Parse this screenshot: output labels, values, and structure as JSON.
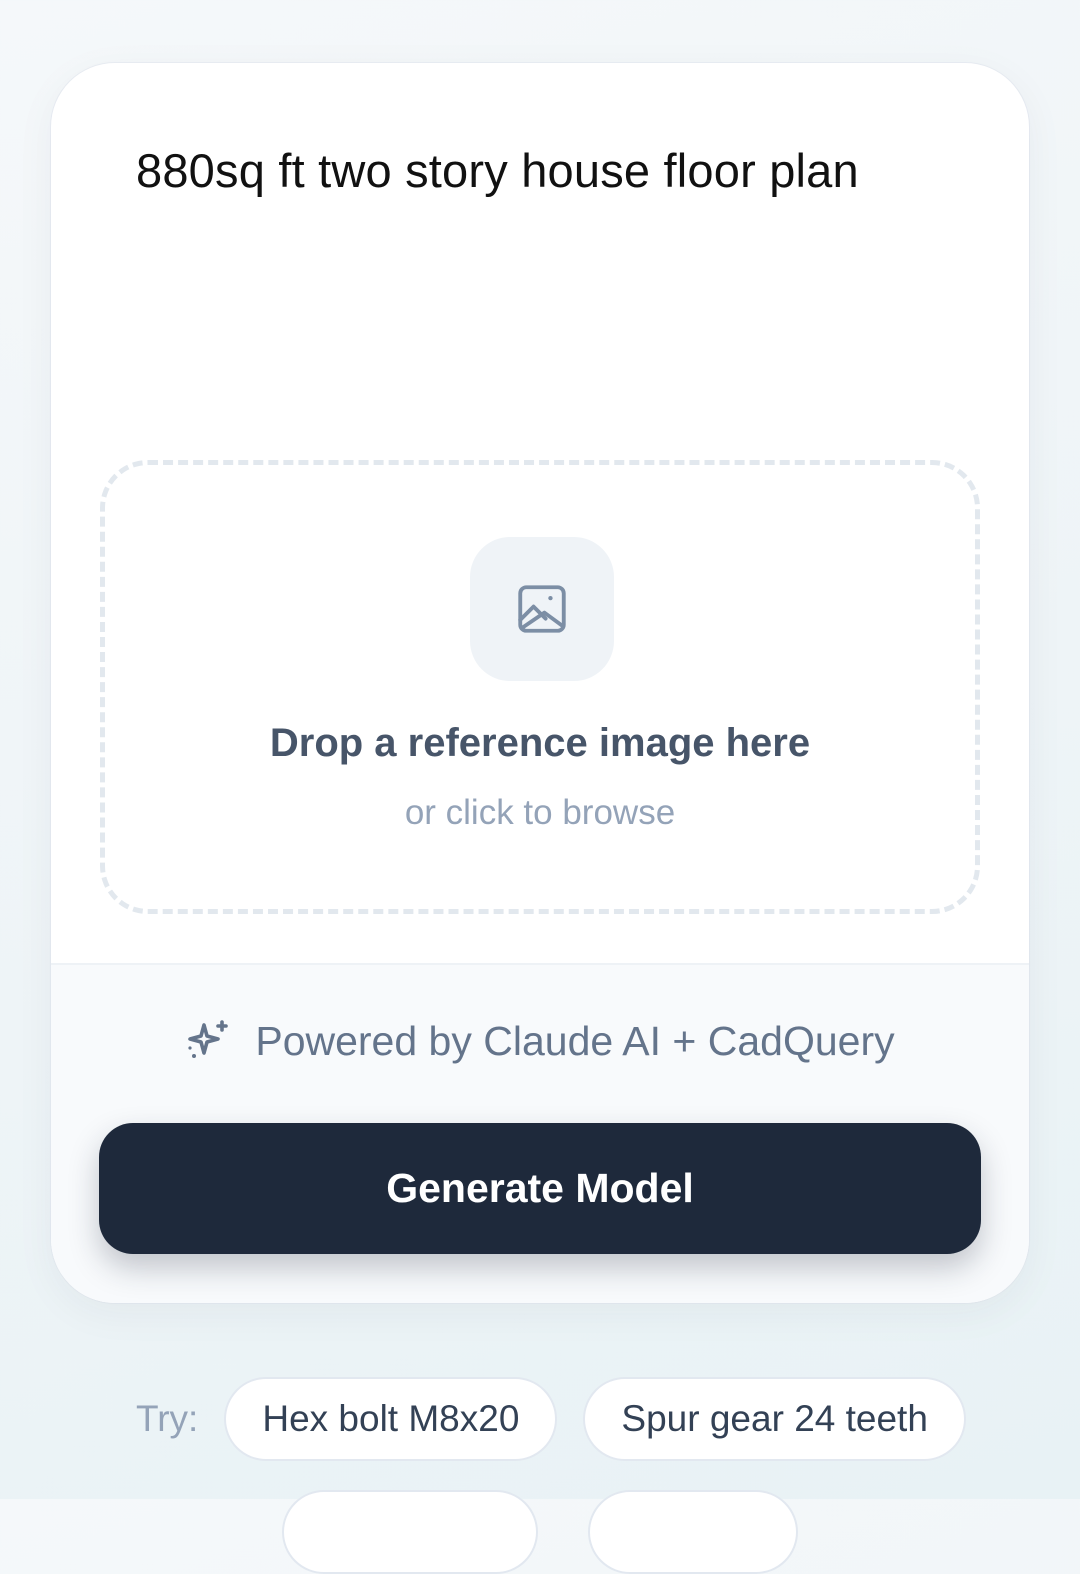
{
  "prompt": {
    "value": "880sq ft two story house floor plan"
  },
  "dropzone": {
    "icon": "image-icon",
    "title": "Drop a reference image here",
    "subtitle": "or click to browse"
  },
  "footer": {
    "powered_icon": "sparkles-icon",
    "powered_text": "Powered by Claude AI + CadQuery",
    "generate_label": "Generate Model"
  },
  "suggestions": {
    "label": "Try:",
    "items": [
      "Hex bolt M8x20",
      "Spur gear 24 teeth"
    ]
  },
  "colors": {
    "primary_button": "#1e293b",
    "muted_text": "#94a3b8",
    "dashed_border": "#e2e8ee"
  }
}
